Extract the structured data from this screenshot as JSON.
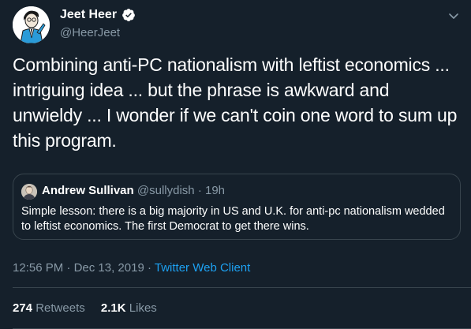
{
  "author": {
    "name": "Jeet Heer",
    "handle": "@HeerJeet",
    "verified": true
  },
  "tweet": {
    "text": "Combining anti-PC nationalism with leftist economics ... intriguing idea ... but the phrase is awkward and unwieldy ... I wonder if we can't coin one word to sum up this program."
  },
  "quoted": {
    "name": "Andrew Sullivan",
    "handle": "@sullydish",
    "separator": "·",
    "time": "19h",
    "text": "Simple lesson: there is a big majority in US and U.K. for anti-pc nationalism wedded to leftist economics. The first Democrat to get there wins."
  },
  "meta": {
    "time": "12:56 PM",
    "separator": "·",
    "date": "Dec 13, 2019",
    "source": "Twitter Web Client"
  },
  "stats": {
    "retweets_count": "274",
    "retweets_label": "Retweets",
    "likes_count": "2.1K",
    "likes_label": "Likes"
  },
  "colors": {
    "background": "#15202b",
    "text_primary": "#ffffff",
    "text_secondary": "#8899a6",
    "accent": "#1da1f2",
    "border": "#38444d"
  },
  "icons": {
    "verified": "verified-badge-icon",
    "more": "chevron-down-icon"
  }
}
